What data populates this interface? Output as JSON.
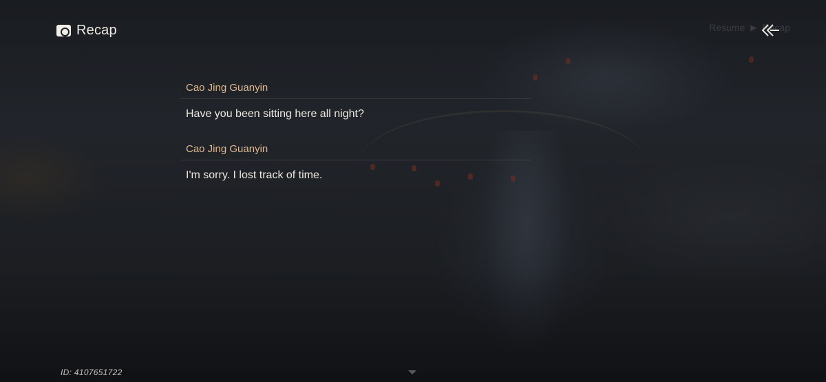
{
  "header": {
    "title": "Recap",
    "icon": "scroll-icon"
  },
  "top_right": {
    "resume_label": "Resume",
    "arrow": "▶",
    "recap_label": "Recap",
    "back_icon": "double-chevron-left-icon"
  },
  "dialog": [
    {
      "speaker": "Cao Jing Guanyin",
      "text": "Have you been sitting here all night?"
    },
    {
      "speaker": "Cao Jing Guanyin",
      "text": "I'm sorry. I lost track of time."
    }
  ],
  "footer": {
    "id_text": "ID: 4107651722",
    "scroll_icon": "chevron-down-icon"
  },
  "colors": {
    "speaker": "#e0b88e",
    "text": "#ece8df"
  }
}
